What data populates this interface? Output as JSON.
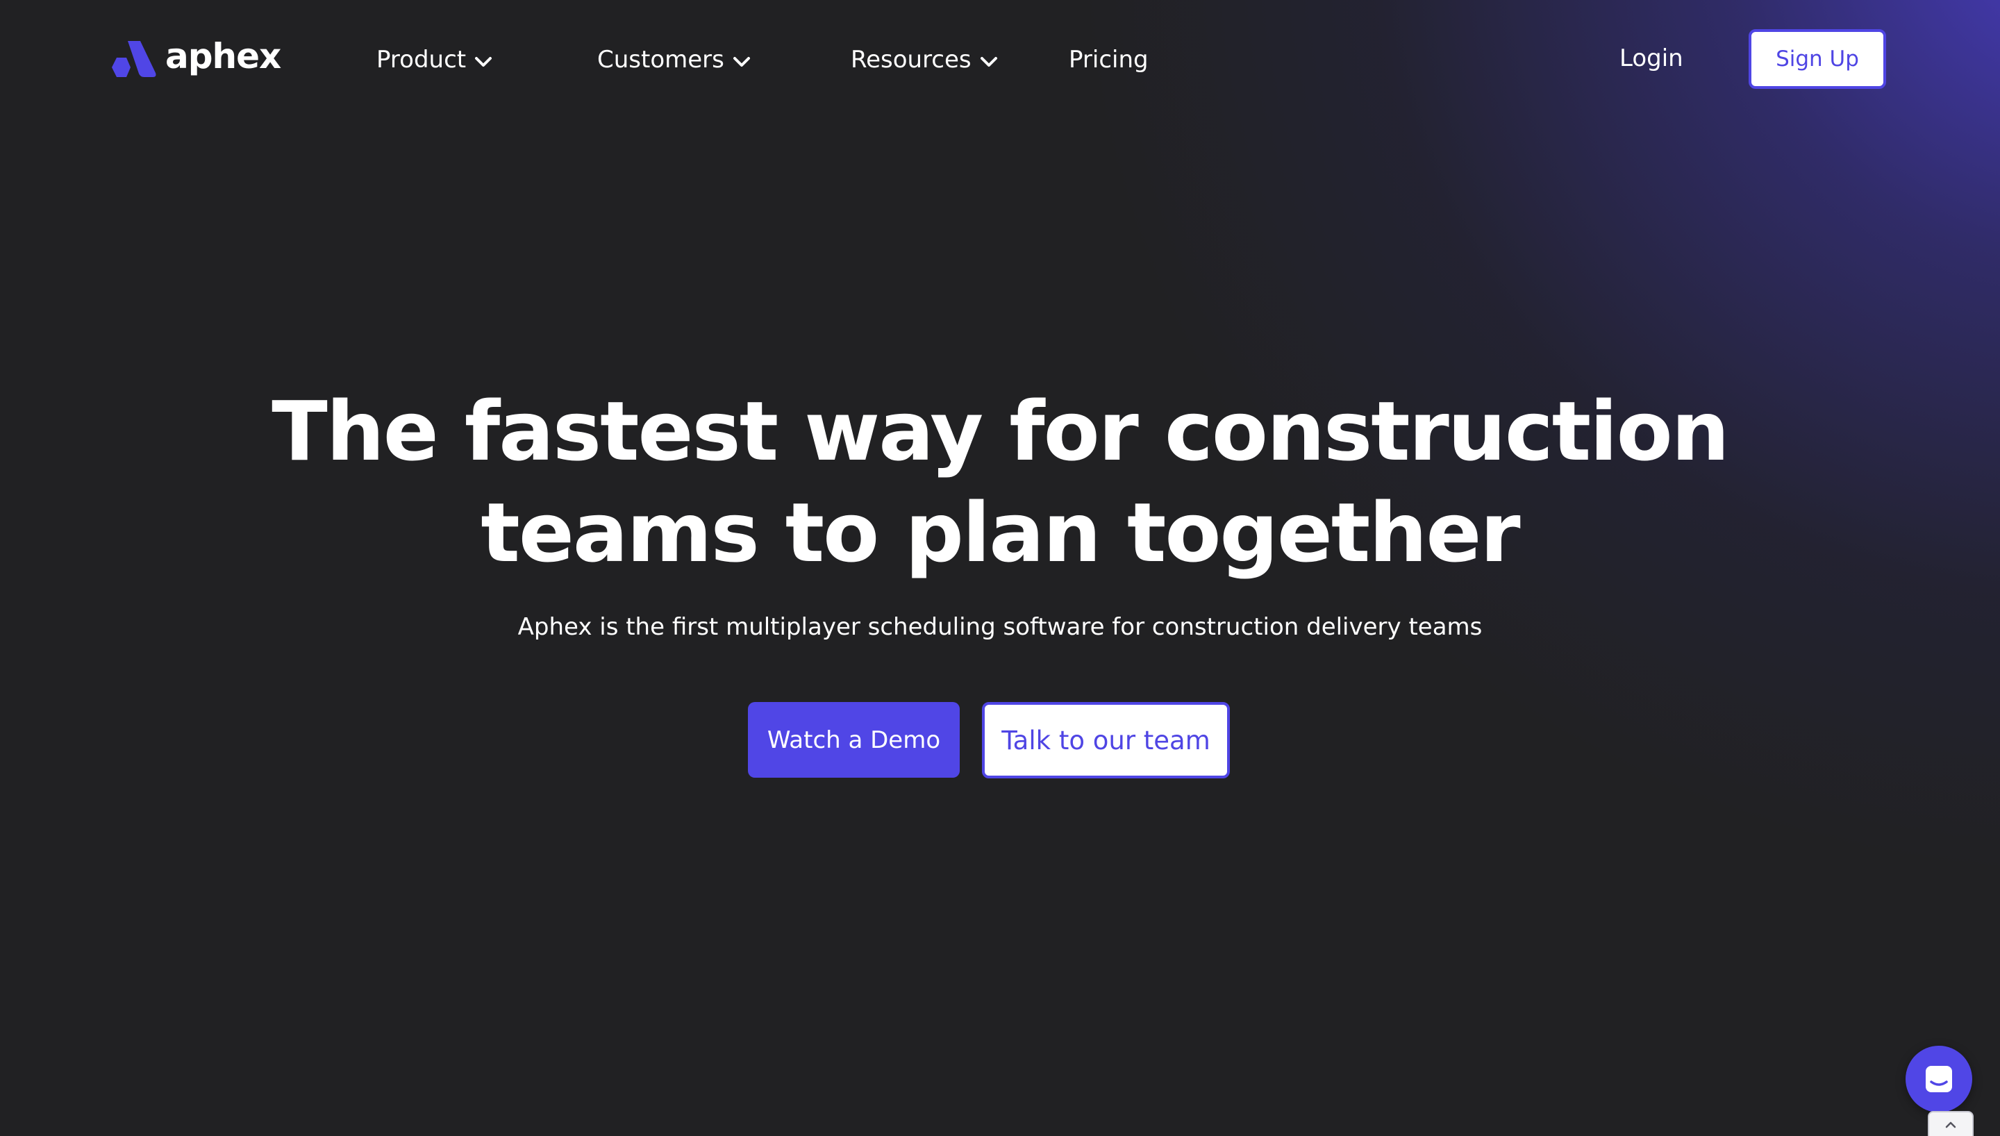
{
  "brand": {
    "name": "aphex",
    "accent_color": "#5046e6",
    "background_color": "#212123"
  },
  "nav": {
    "items": [
      {
        "label": "Product",
        "icon": "chevron-down-icon"
      },
      {
        "label": "Customers",
        "icon": "chevron-down-icon"
      },
      {
        "label": "Resources",
        "icon": "chevron-down-icon"
      },
      {
        "label": "Pricing"
      }
    ],
    "login_label": "Login",
    "signup_label": "Sign Up"
  },
  "hero": {
    "title_line1": "The fastest way for construction",
    "title_line2": "teams to plan together",
    "subtitle": "Aphex is the first multiplayer scheduling software for construction delivery teams",
    "primary_cta": "Watch a Demo",
    "secondary_cta": "Talk to our team"
  },
  "widgets": {
    "chat_icon": "chat-bubble-icon",
    "scroll_icon": "chevron-up-icon"
  }
}
